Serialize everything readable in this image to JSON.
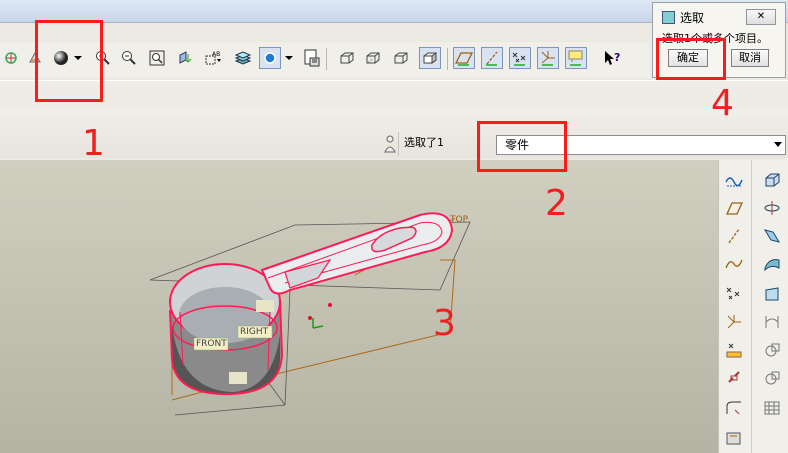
{
  "dialog": {
    "title": "选取",
    "message": "选取1个或多个项目。",
    "ok_label": "确定",
    "cancel_label": "取消",
    "close_label": "✕"
  },
  "filter": {
    "status_text": "选取了1",
    "selected": "零件"
  },
  "model": {
    "datum_top": "TOP",
    "datum_front": "FRONT",
    "datum_right": "RIGHT"
  },
  "annotations": {
    "n1": "1",
    "n2": "2",
    "n3": "3",
    "n4": "4"
  },
  "toolbar_icons": [
    "spin-center-icon",
    "repaint-icon",
    "shading-icon",
    "zoom-in-icon",
    "zoom-out-icon",
    "refit-icon",
    "reorient-icon",
    "saved-views-icon",
    "layers-icon",
    "view-manager-icon",
    "save-view-icon",
    "wireframe-icon",
    "hidden-line-icon",
    "no-hidden-icon",
    "shaded-icon",
    "datum-plane-display-icon",
    "datum-axis-display-icon",
    "point-display-icon",
    "csys-display-icon",
    "annotation-display-icon",
    "help-icon"
  ],
  "colors": {
    "selection": "#ff1a55",
    "annotation": "#ff1a1a",
    "viewport_top": "#d1cfc0",
    "viewport_bottom": "#b5b3a3"
  }
}
